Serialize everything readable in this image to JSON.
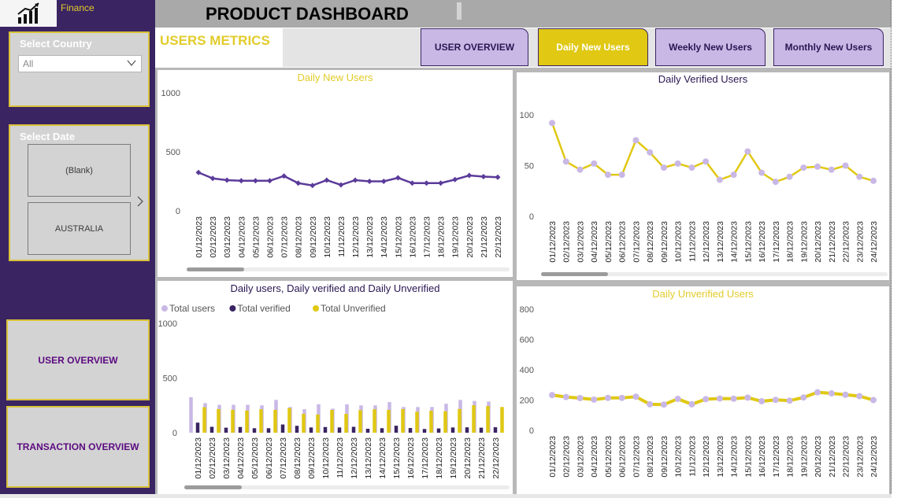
{
  "app": {
    "workspace_label": "Finance",
    "dashboard_title": "PRODUCT DASHBOARD",
    "section_title": "USERS METRICS"
  },
  "colors": {
    "purple_dark": "#3a2462",
    "purple_line": "#5b3b9a",
    "lavender": "#c9b8e6",
    "yellow": "#e0c813",
    "title_yellow": "#e2cc2b",
    "nav_text": "#5b0a80"
  },
  "filters": {
    "country": {
      "title": "Select Country",
      "value": "All"
    },
    "date": {
      "title": "Select Date",
      "tiles": [
        "(Blank)",
        "AUSTRALIA"
      ]
    }
  },
  "side_nav": [
    "USER OVERVIEW",
    "TRANSACTION OVERVIEW"
  ],
  "tabs": [
    {
      "label": "USER OVERVIEW",
      "active": false
    },
    {
      "label": "Daily New Users",
      "active": true
    },
    {
      "label": "Weekly New Users",
      "active": false
    },
    {
      "label": "Monthly New Users",
      "active": false
    }
  ],
  "icons": {
    "logo": "bar-chart-trend-icon",
    "dropdown": "chevron-down-icon",
    "next": "chevron-right-icon"
  },
  "chart_data": [
    {
      "id": "daily_new_users",
      "type": "line",
      "title": "Daily New Users",
      "categories": [
        "01/12/2023",
        "02/12/2023",
        "03/12/2023",
        "04/12/2023",
        "05/12/2023",
        "06/12/2023",
        "07/12/2023",
        "08/12/2023",
        "09/12/2023",
        "10/12/2023",
        "11/12/2023",
        "12/12/2023",
        "13/12/2023",
        "14/12/2023",
        "15/12/2023",
        "16/12/2023",
        "17/12/2023",
        "18/12/2023",
        "19/12/2023",
        "20/12/2023",
        "21/12/2023",
        "22/12/2023"
      ],
      "values": [
        325,
        275,
        260,
        255,
        255,
        255,
        295,
        235,
        215,
        260,
        220,
        260,
        250,
        250,
        280,
        235,
        235,
        235,
        265,
        300,
        290,
        285
      ],
      "ylim": [
        0,
        1000
      ],
      "yticks": [
        0,
        500,
        1000
      ],
      "color": "#5b3b9a"
    },
    {
      "id": "daily_verified_users",
      "type": "line",
      "title": "Daily Verified Users",
      "categories": [
        "01/12/2023",
        "02/12/2023",
        "03/12/2023",
        "04/12/2023",
        "05/12/2023",
        "06/12/2023",
        "07/12/2023",
        "08/12/2023",
        "09/12/2023",
        "10/12/2023",
        "11/12/2023",
        "12/12/2023",
        "13/12/2023",
        "14/12/2023",
        "15/12/2023",
        "16/12/2023",
        "17/12/2023",
        "18/12/2023",
        "19/12/2023",
        "20/12/2023",
        "21/12/2023",
        "22/12/2023",
        "23/12/2023",
        "24/12/2023"
      ],
      "values": [
        92,
        54,
        46,
        52,
        41,
        41,
        75,
        63,
        48,
        52,
        48,
        54,
        36,
        41,
        64,
        43,
        34,
        39,
        48,
        49,
        46,
        50,
        39,
        35
      ],
      "ylim": [
        0,
        100
      ],
      "yticks": [
        0,
        50,
        100
      ],
      "color": "#e0c813",
      "marker_color": "#c9b8e6"
    },
    {
      "id": "daily_users_breakdown",
      "type": "bar",
      "title": "Daily users, Daily verified and Daily Unverified",
      "categories": [
        "01/12/2023",
        "02/12/2023",
        "03/12/2023",
        "04/12/2023",
        "05/12/2023",
        "06/12/2023",
        "07/12/2023",
        "08/12/2023",
        "09/12/2023",
        "10/12/2023",
        "11/12/2023",
        "12/12/2023",
        "13/12/2023",
        "14/12/2023",
        "15/12/2023",
        "16/12/2023",
        "17/12/2023",
        "18/12/2023",
        "19/12/2023",
        "20/12/2023",
        "21/12/2023",
        "22/12/2023"
      ],
      "series": [
        {
          "name": "Total users",
          "color": "#c9b8e6",
          "values": [
            325,
            270,
            255,
            255,
            255,
            250,
            300,
            235,
            215,
            260,
            220,
            260,
            250,
            250,
            280,
            235,
            235,
            235,
            265,
            300,
            290,
            285
          ]
        },
        {
          "name": "Total verified",
          "color": "#3a2462",
          "values": [
            92,
            54,
            46,
            52,
            41,
            41,
            75,
            63,
            48,
            52,
            48,
            54,
            36,
            41,
            64,
            43,
            34,
            39,
            48,
            49,
            46,
            50
          ]
        },
        {
          "name": "Total Unverified",
          "color": "#e0c813",
          "values": [
            233,
            216,
            209,
            203,
            214,
            209,
            225,
            172,
            167,
            208,
            172,
            206,
            214,
            209,
            216,
            192,
            201,
            196,
            217,
            251,
            244,
            235
          ]
        }
      ],
      "ylim": [
        0,
        1000
      ],
      "yticks": [
        0,
        500,
        1000
      ],
      "legend": "top-left"
    },
    {
      "id": "daily_unverified_users",
      "type": "line",
      "title": "Daily Unverified Users",
      "categories": [
        "01/12/2023",
        "02/12/2023",
        "03/12/2023",
        "04/12/2023",
        "05/12/2023",
        "06/12/2023",
        "07/12/2023",
        "08/12/2023",
        "09/12/2023",
        "10/12/2023",
        "11/12/2023",
        "12/12/2023",
        "13/12/2023",
        "14/12/2023",
        "15/12/2023",
        "16/12/2023",
        "17/12/2023",
        "18/12/2023",
        "19/12/2023",
        "20/12/2023",
        "21/12/2023",
        "22/12/2023",
        "23/12/2023",
        "24/12/2023"
      ],
      "values": [
        233,
        220,
        213,
        203,
        214,
        214,
        222,
        172,
        170,
        208,
        172,
        206,
        210,
        209,
        216,
        192,
        201,
        196,
        217,
        251,
        244,
        235,
        226,
        200
      ],
      "ylim": [
        0,
        800
      ],
      "yticks": [
        0,
        200,
        400,
        600,
        800
      ],
      "color": "#e0c813",
      "marker_color": "#c9b8e6"
    }
  ]
}
